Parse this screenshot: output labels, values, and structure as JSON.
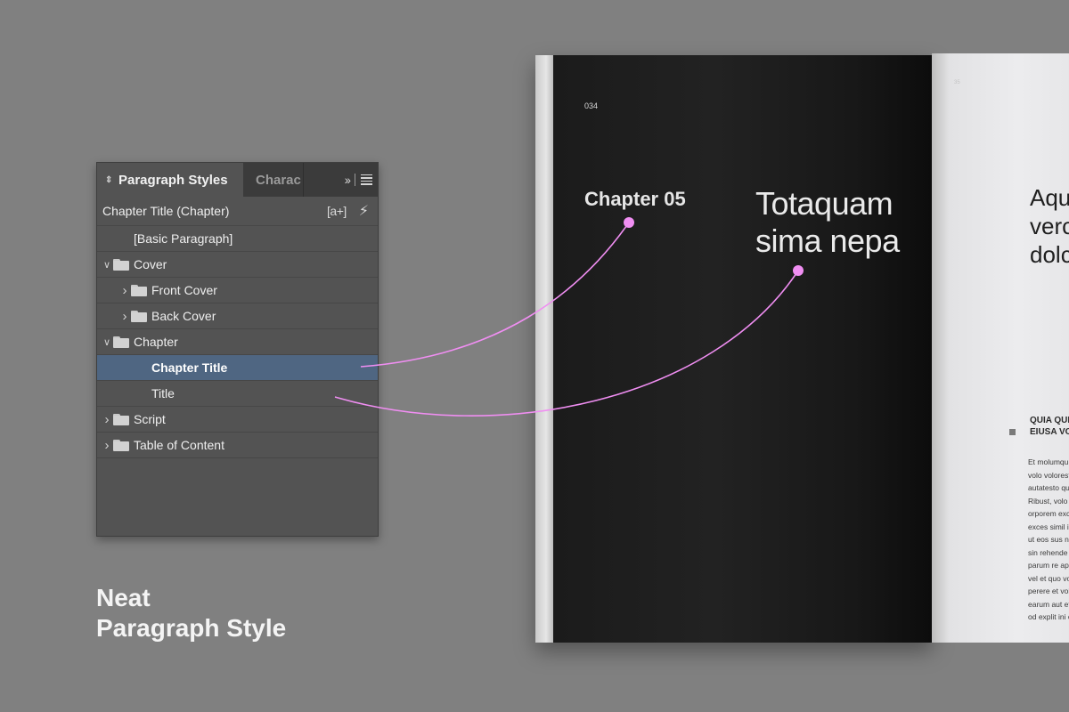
{
  "panel": {
    "active_tab": "Paragraph Styles",
    "inactive_tab": "Charac",
    "current_style": "Chapter Title (Chapter)",
    "new_style_icon": "[a+]",
    "items": [
      {
        "label": "[Basic Paragraph]",
        "type": "style",
        "indent": 0,
        "chevron": ""
      },
      {
        "label": "Cover",
        "type": "folder",
        "indent": 0,
        "chevron": "expanded"
      },
      {
        "label": "Front Cover",
        "type": "folder",
        "indent": 1,
        "chevron": "collapsed"
      },
      {
        "label": "Back Cover",
        "type": "folder",
        "indent": 1,
        "chevron": "collapsed"
      },
      {
        "label": "Chapter",
        "type": "folder",
        "indent": 0,
        "chevron": "expanded"
      },
      {
        "label": "Chapter Title",
        "type": "style",
        "indent": 1,
        "chevron": "",
        "selected": true
      },
      {
        "label": "Title",
        "type": "style",
        "indent": 1,
        "chevron": ""
      },
      {
        "label": "Script",
        "type": "folder",
        "indent": 0,
        "chevron": "collapsed"
      },
      {
        "label": "Table of Content",
        "type": "folder",
        "indent": 0,
        "chevron": "collapsed"
      }
    ]
  },
  "caption": {
    "line1": "Neat",
    "line2": "Paragraph Style"
  },
  "book": {
    "page_number": "034",
    "chapter_label": "Chapter 05",
    "title_line1": "Totaquam",
    "title_line2": "sima nepa",
    "right_page_number": "35",
    "right_heading": [
      "Aqu",
      "verc",
      "dolc"
    ],
    "right_subheading": [
      "QUIA QUI",
      "EIUSA VO"
    ],
    "right_body": [
      "Et molumqu",
      "volo volorest",
      "autatesto qu",
      "Ribust, volo e",
      "orporem exc",
      "exces simil is",
      "ut eos sus nu",
      "sin rehende s",
      "parum re ape",
      "vel et quo vo",
      "perere et volo",
      "earum aut et",
      "od explit ini o"
    ]
  },
  "colors": {
    "selection": "#4f6682",
    "connector": "#f08ef2",
    "panel_bg": "#535353"
  }
}
